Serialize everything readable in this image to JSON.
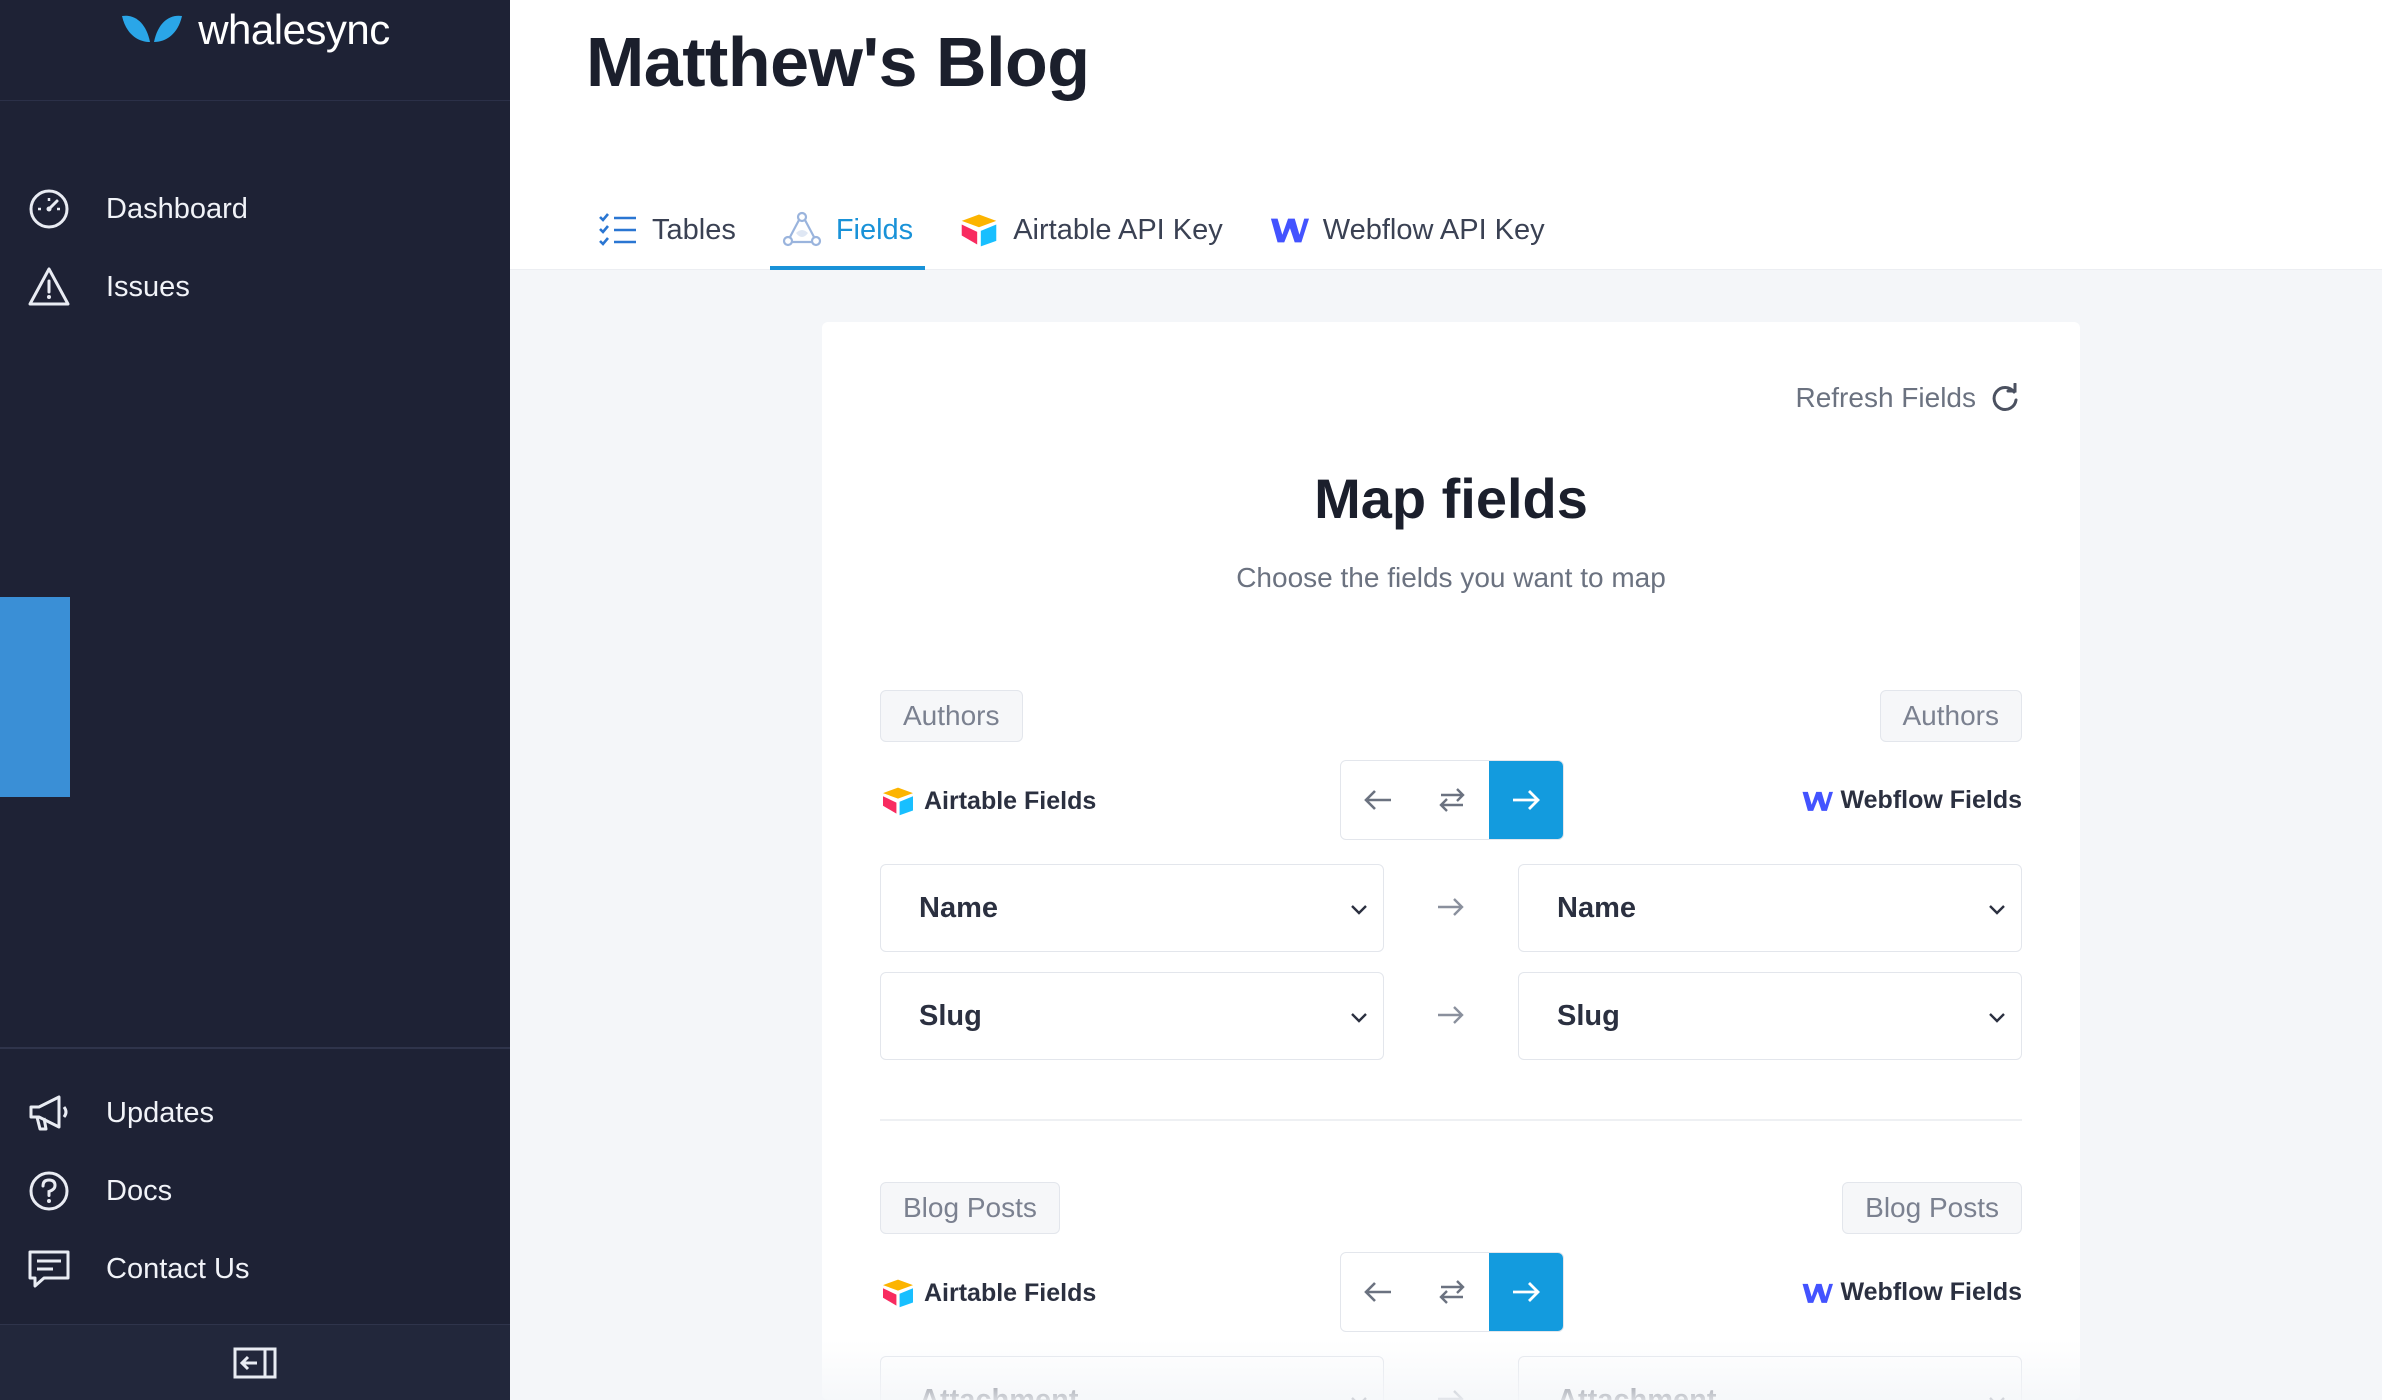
{
  "sidebar": {
    "brand": "whalesync",
    "top_items": [
      {
        "label": "Dashboard",
        "icon": "speedometer-icon"
      },
      {
        "label": "Issues",
        "icon": "warning-icon"
      }
    ],
    "bottom_items": [
      {
        "label": "Updates",
        "icon": "megaphone-icon"
      },
      {
        "label": "Docs",
        "icon": "help-circle-icon"
      },
      {
        "label": "Contact Us",
        "icon": "chat-icon"
      }
    ],
    "collapse_icon": "collapse-sidebar-icon"
  },
  "header": {
    "title": "Matthew's Blog",
    "tabs": [
      {
        "label": "Tables",
        "icon": "checklist-icon",
        "active": false
      },
      {
        "label": "Fields",
        "icon": "network-icon",
        "active": true
      },
      {
        "label": "Airtable API Key",
        "icon": "airtable-logo-icon",
        "active": false
      },
      {
        "label": "Webflow API Key",
        "icon": "webflow-logo-icon",
        "active": false
      }
    ]
  },
  "main": {
    "refresh_label": "Refresh Fields",
    "title": "Map fields",
    "subtitle": "Choose the fields you want to map",
    "mappings": [
      {
        "left_table": "Authors",
        "right_table": "Authors",
        "left_source": "Airtable Fields",
        "right_source": "Webflow Fields",
        "direction": "right",
        "fields": [
          {
            "left": "Name",
            "right": "Name"
          },
          {
            "left": "Slug",
            "right": "Slug"
          }
        ]
      },
      {
        "left_table": "Blog Posts",
        "right_table": "Blog Posts",
        "left_source": "Airtable Fields",
        "right_source": "Webflow Fields",
        "direction": "right",
        "fields": [
          {
            "left": "Attachment",
            "right": "Attachment"
          }
        ]
      }
    ]
  },
  "colors": {
    "sidebar_bg": "#1e2235",
    "accent": "#1992d8",
    "active_direction": "#139bde"
  }
}
